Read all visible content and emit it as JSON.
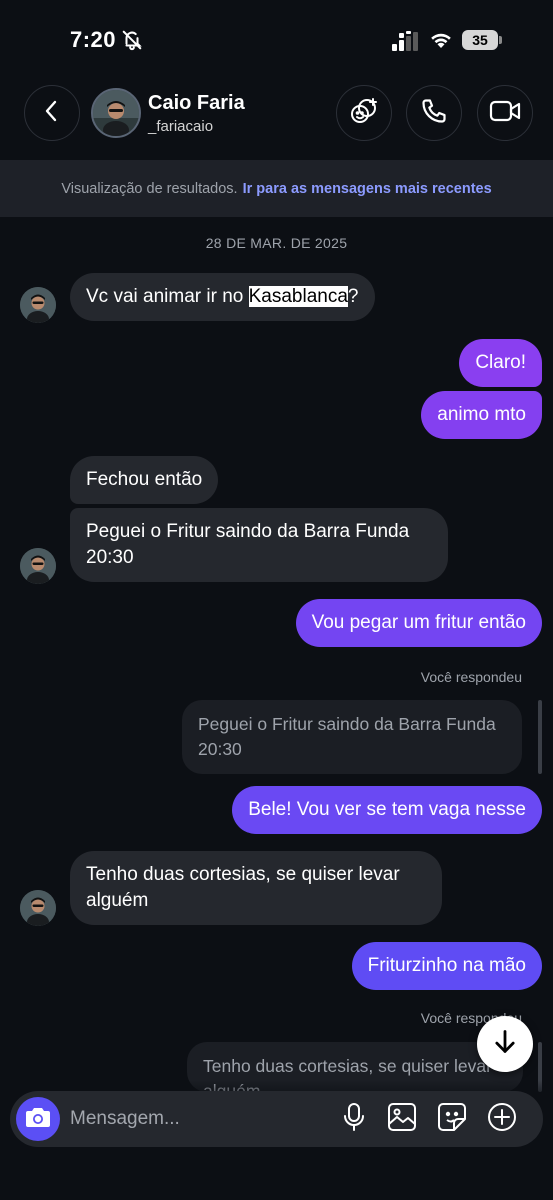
{
  "status": {
    "time": "7:20",
    "battery": "35"
  },
  "header": {
    "name": "Caio Faria",
    "handle": "_fariacaio"
  },
  "banner": {
    "text": "Visualização de resultados.",
    "link": "Ir para as mensagens mais recentes"
  },
  "date_separator": "28 DE MAR. DE 2025",
  "messages": [
    {
      "from": "them",
      "text_before": "Vc vai animar ir no ",
      "highlight": "Kasablanca",
      "text_after": "?"
    },
    {
      "from": "me",
      "text": "Claro!"
    },
    {
      "from": "me",
      "text": "animo mto"
    },
    {
      "from": "them",
      "text": "Fechou então"
    },
    {
      "from": "them",
      "text": "Peguei o Fritur saindo da Barra Funda 20:30"
    },
    {
      "from": "me",
      "text": "Vou pegar um fritur então"
    },
    {
      "from": "me",
      "replied_label": "Você respondeu",
      "quote": "Peguei o Fritur saindo da Barra Funda 20:30",
      "text": "Bele! Vou ver se tem vaga nesse"
    },
    {
      "from": "them",
      "text": "Tenho duas cortesias, se quiser levar alguém"
    },
    {
      "from": "me",
      "text": "Friturzinho na mão"
    },
    {
      "from": "me",
      "replied_label": "Você respondeu",
      "quote": "Tenho duas cortesias, se quiser levar alguém"
    }
  ],
  "composer": {
    "placeholder": "Mensagem..."
  },
  "colors": {
    "background": "#0c0f14",
    "incoming_bubble": "#25282e",
    "outgoing_top": "#8a3ff0",
    "outgoing_bottom": "#5b4ff5",
    "link": "#8c9bff"
  },
  "icons": [
    "bell-off-icon",
    "signal-icon",
    "wifi-icon",
    "battery-icon",
    "back-icon",
    "effects-icon",
    "phone-icon",
    "video-icon",
    "arrow-down-icon",
    "camera-icon",
    "microphone-icon",
    "image-icon",
    "sticker-icon",
    "plus-icon"
  ]
}
